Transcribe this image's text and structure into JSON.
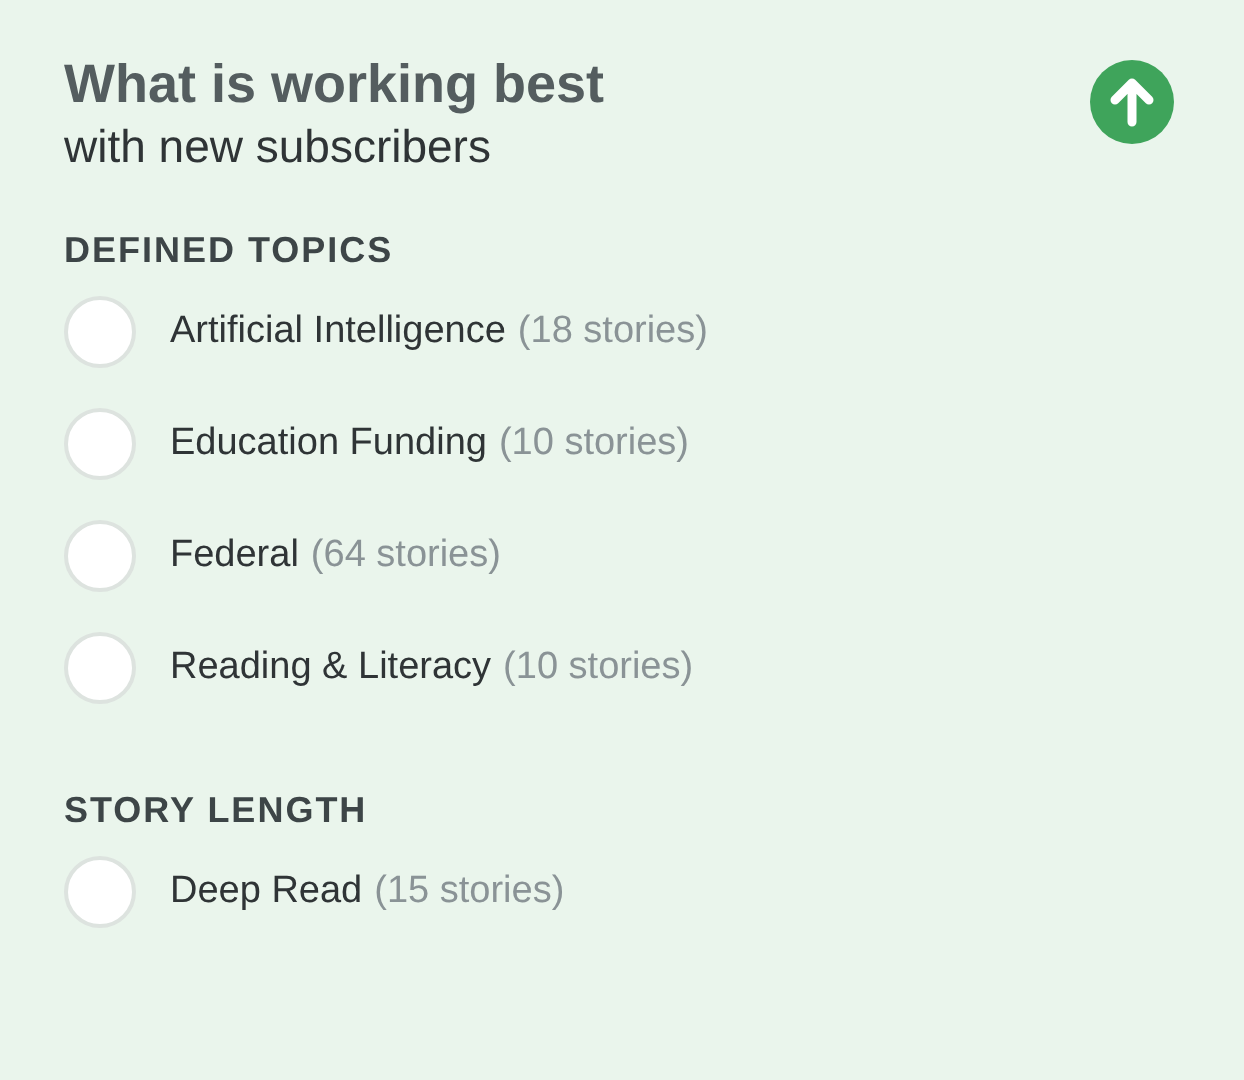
{
  "title": "What is working best",
  "subtitle": "with new subscribers",
  "sections": [
    {
      "heading": "DEFINED TOPICS",
      "items": [
        {
          "label": "Artificial Intelligence",
          "count": "(18 stories)",
          "selected": false
        },
        {
          "label": "Education Funding",
          "count": "(10 stories)",
          "selected": false
        },
        {
          "label": "Federal",
          "count": "(64 stories)",
          "selected": false
        },
        {
          "label": "Reading & Literacy",
          "count": "(10 stories)",
          "selected": false
        }
      ]
    },
    {
      "heading": "STORY LENGTH",
      "items": [
        {
          "label": "Deep Read",
          "count": "(15 stories)",
          "selected": false
        }
      ]
    }
  ]
}
